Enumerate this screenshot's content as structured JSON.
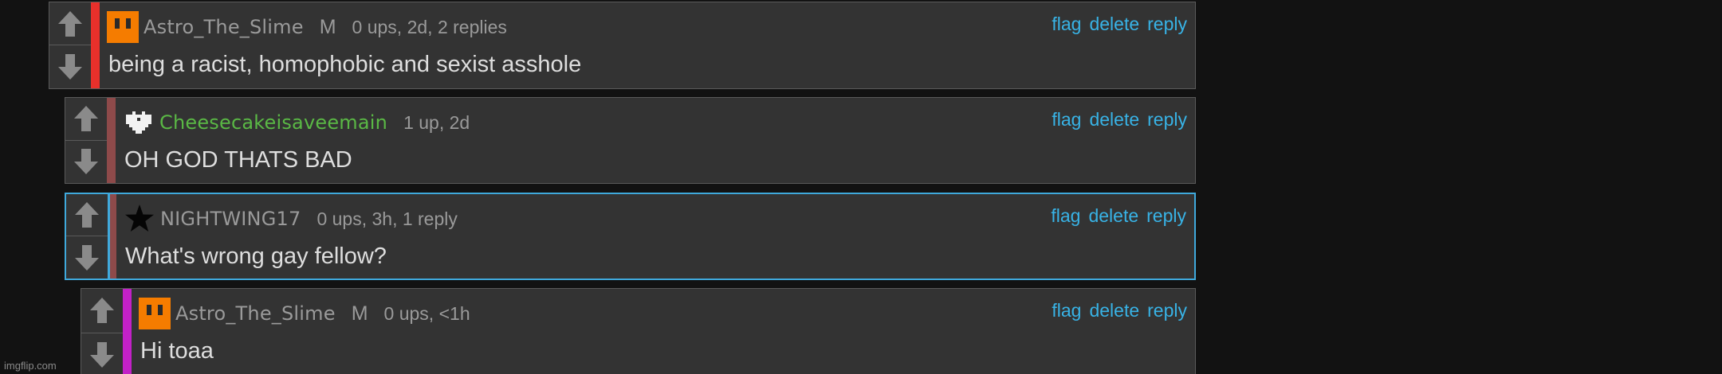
{
  "comments": [
    {
      "username": "Astro_The_Slime",
      "badge": "M",
      "meta": "0 ups, 2d, 2 replies",
      "text": "being a racist, homophobic and sexist asshole",
      "avatar_icon": "orange-square-face-icon",
      "bar_color": "#e8302b"
    },
    {
      "username": "Cheesecakeisaveemain",
      "meta": "1 up, 2d",
      "text": "OH GOD THATS BAD",
      "avatar_icon": "white-pixel-heart-icon",
      "username_color": "#5ab845",
      "bar_color": "#8e4a4a"
    },
    {
      "username": "NIGHTWING17",
      "meta": "0 ups, 3h, 1 reply",
      "text": "What's wrong gay fellow?",
      "avatar_icon": "black-star-icon",
      "bar_color": "#8e4a4a",
      "highlight_color": "#3fa9dc"
    },
    {
      "username": "Astro_The_Slime",
      "badge": "M",
      "meta": "0 ups, <1h",
      "text": "Hi toaa",
      "avatar_icon": "orange-square-face-icon",
      "bar_color": "#c321c8"
    }
  ],
  "actions": {
    "flag": "flag",
    "delete": "delete",
    "reply": "reply"
  },
  "watermark": "imgflip.com",
  "colors": {
    "background": "#121212",
    "panel": "#333333",
    "link": "#38b3e6",
    "text": "#dedede",
    "muted": "#9a9a9a"
  }
}
